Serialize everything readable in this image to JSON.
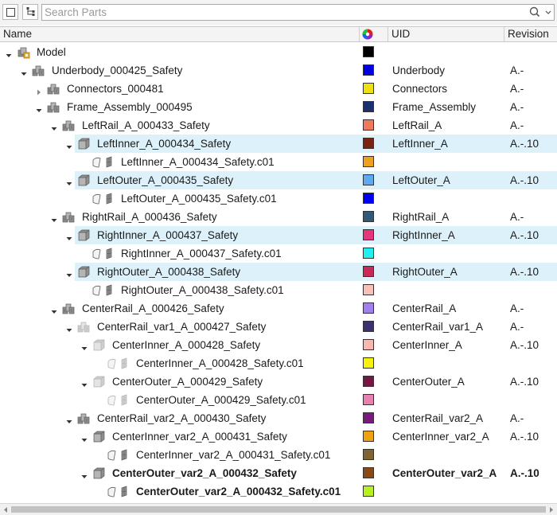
{
  "search": {
    "placeholder": "Search Parts"
  },
  "columns": {
    "name": "Name",
    "uid": "UID",
    "revision": "Revision"
  },
  "rows": [
    {
      "depth": 0,
      "toggle": "down",
      "icon": "model",
      "label": "Model",
      "color": "#000000",
      "uid": "",
      "rev": "",
      "sel": false,
      "bold": false
    },
    {
      "depth": 1,
      "toggle": "down",
      "icon": "assembly",
      "label": "Underbody_000425_Safety",
      "color": "#0000e0",
      "uid": "Underbody",
      "rev": "A.-",
      "sel": false,
      "bold": false
    },
    {
      "depth": 2,
      "toggle": "right",
      "icon": "assembly",
      "label": "Connectors_000481",
      "color": "#f0e010",
      "uid": "Connectors",
      "rev": "A.-",
      "sel": false,
      "bold": false
    },
    {
      "depth": 2,
      "toggle": "down",
      "icon": "assembly",
      "label": "Frame_Assembly_000495",
      "color": "#1c3070",
      "uid": "Frame_Assembly",
      "rev": "A.-",
      "sel": false,
      "bold": false
    },
    {
      "depth": 3,
      "toggle": "down",
      "icon": "assembly",
      "label": "LeftRail_A_000433_Safety",
      "color": "#f07860",
      "uid": "LeftRail_A",
      "rev": "A.-",
      "sel": false,
      "bold": false
    },
    {
      "depth": 4,
      "toggle": "down",
      "icon": "part",
      "label": "LeftInner_A_000434_Safety",
      "color": "#7a2410",
      "uid": "LeftInner_A",
      "rev": "A.-.10",
      "sel": true,
      "bold": false
    },
    {
      "depth": 5,
      "toggle": "",
      "icon": "body",
      "label": "LeftInner_A_000434_Safety.c01",
      "color": "#f0a020",
      "uid": "",
      "rev": "",
      "sel": false,
      "bold": false
    },
    {
      "depth": 4,
      "toggle": "down",
      "icon": "part",
      "label": "LeftOuter_A_000435_Safety",
      "color": "#60a8f0",
      "uid": "LeftOuter_A",
      "rev": "A.-.10",
      "sel": true,
      "bold": false
    },
    {
      "depth": 5,
      "toggle": "",
      "icon": "body",
      "label": "LeftOuter_A_000435_Safety.c01",
      "color": "#0000f0",
      "uid": "",
      "rev": "",
      "sel": false,
      "bold": false
    },
    {
      "depth": 3,
      "toggle": "down",
      "icon": "assembly",
      "label": "RightRail_A_000436_Safety",
      "color": "#34587a",
      "uid": "RightRail_A",
      "rev": "A.-",
      "sel": false,
      "bold": false
    },
    {
      "depth": 4,
      "toggle": "down",
      "icon": "part",
      "label": "RightInner_A_000437_Safety",
      "color": "#e8347a",
      "uid": "RightInner_A",
      "rev": "A.-.10",
      "sel": true,
      "bold": false
    },
    {
      "depth": 5,
      "toggle": "",
      "icon": "body",
      "label": "RightInner_A_000437_Safety.c01",
      "color": "#20f0f0",
      "uid": "",
      "rev": "",
      "sel": false,
      "bold": false
    },
    {
      "depth": 4,
      "toggle": "down",
      "icon": "part",
      "label": "RightOuter_A_000438_Safety",
      "color": "#c8285a",
      "uid": "RightOuter_A",
      "rev": "A.-.10",
      "sel": true,
      "bold": false
    },
    {
      "depth": 5,
      "toggle": "",
      "icon": "body",
      "label": "RightOuter_A_000438_Safety.c01",
      "color": "#f8c0bc",
      "uid": "",
      "rev": "",
      "sel": false,
      "bold": false
    },
    {
      "depth": 3,
      "toggle": "down",
      "icon": "assembly",
      "label": "CenterRail_A_000426_Safety",
      "color": "#a080f0",
      "uid": "CenterRail_A",
      "rev": "A.-",
      "sel": false,
      "bold": false
    },
    {
      "depth": 4,
      "toggle": "down",
      "icon": "assembly-light",
      "label": "CenterRail_var1_A_000427_Safety",
      "color": "#3c3070",
      "uid": "CenterRail_var1_A",
      "rev": "A.-",
      "sel": false,
      "bold": false
    },
    {
      "depth": 5,
      "toggle": "down",
      "icon": "part-light",
      "label": "CenterInner_A_000428_Safety",
      "color": "#f8b8b0",
      "uid": "CenterInner_A",
      "rev": "A.-.10",
      "sel": false,
      "bold": false
    },
    {
      "depth": 6,
      "toggle": "",
      "icon": "body-light",
      "label": "CenterInner_A_000428_Safety.c01",
      "color": "#f8f010",
      "uid": "",
      "rev": "",
      "sel": false,
      "bold": false
    },
    {
      "depth": 5,
      "toggle": "down",
      "icon": "part-light",
      "label": "CenterOuter_A_000429_Safety",
      "color": "#701848",
      "uid": "CenterOuter_A",
      "rev": "A.-.10",
      "sel": false,
      "bold": false
    },
    {
      "depth": 6,
      "toggle": "",
      "icon": "body-light",
      "label": "CenterOuter_A_000429_Safety.c01",
      "color": "#e880b0",
      "uid": "",
      "rev": "",
      "sel": false,
      "bold": false
    },
    {
      "depth": 4,
      "toggle": "down",
      "icon": "assembly",
      "label": "CenterRail_var2_A_000430_Safety",
      "color": "#781c7a",
      "uid": "CenterRail_var2_A",
      "rev": "A.-",
      "sel": false,
      "bold": false
    },
    {
      "depth": 5,
      "toggle": "down",
      "icon": "part",
      "label": "CenterInner_var2_A_000431_Safety",
      "color": "#f0a010",
      "uid": "CenterInner_var2_A",
      "rev": "A.-.10",
      "sel": false,
      "bold": false
    },
    {
      "depth": 6,
      "toggle": "",
      "icon": "body",
      "label": "CenterInner_var2_A_000431_Safety.c01",
      "color": "#806430",
      "uid": "",
      "rev": "",
      "sel": false,
      "bold": false
    },
    {
      "depth": 5,
      "toggle": "down",
      "icon": "part",
      "label": "CenterOuter_var2_A_000432_Safety",
      "color": "#8a4a18",
      "uid": "CenterOuter_var2_A",
      "rev": "A.-.10",
      "sel": false,
      "bold": true
    },
    {
      "depth": 6,
      "toggle": "",
      "icon": "body",
      "label": "CenterOuter_var2_A_000432_Safety.c01",
      "color": "#b8f020",
      "uid": "",
      "rev": "",
      "sel": false,
      "bold": true
    }
  ]
}
